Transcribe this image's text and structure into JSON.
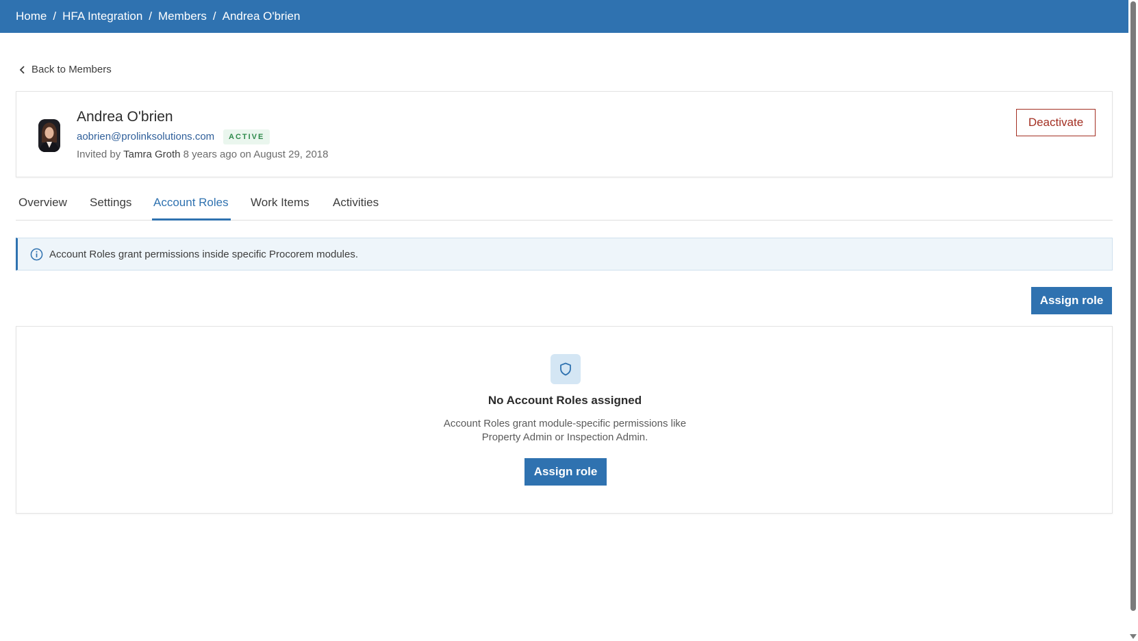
{
  "breadcrumb": {
    "items": [
      "Home",
      "HFA Integration",
      "Members",
      "Andrea O'brien"
    ],
    "separator": "/"
  },
  "back_link": {
    "label": "Back to Members",
    "icon": "chevron-left-icon"
  },
  "member": {
    "name": "Andrea O'brien",
    "email": "aobrien@prolinksolutions.com",
    "status": "ACTIVE",
    "invited_prefix": "Invited by",
    "invited_by": "Tamra Groth",
    "invited_when": "8 years ago on August 29, 2018",
    "deactivate_label": "Deactivate"
  },
  "tabs": [
    {
      "label": "Overview",
      "active": false
    },
    {
      "label": "Settings",
      "active": false
    },
    {
      "label": "Account Roles",
      "active": true
    },
    {
      "label": "Work Items",
      "active": false
    },
    {
      "label": "Activities",
      "active": false
    }
  ],
  "info_banner": {
    "icon": "info-icon",
    "text": "Account Roles grant permissions inside specific Procorem modules."
  },
  "actions": {
    "assign_role_label": "Assign role"
  },
  "empty_state": {
    "icon": "shield-icon",
    "title": "No Account Roles assigned",
    "description": "Account Roles grant module-specific permissions like Property Admin or Inspection Admin.",
    "button_label": "Assign role"
  },
  "colors": {
    "brand": "#2f72b0",
    "danger": "#a32f22",
    "success": "#2e8a4b",
    "info_bg": "#eef5fa"
  }
}
